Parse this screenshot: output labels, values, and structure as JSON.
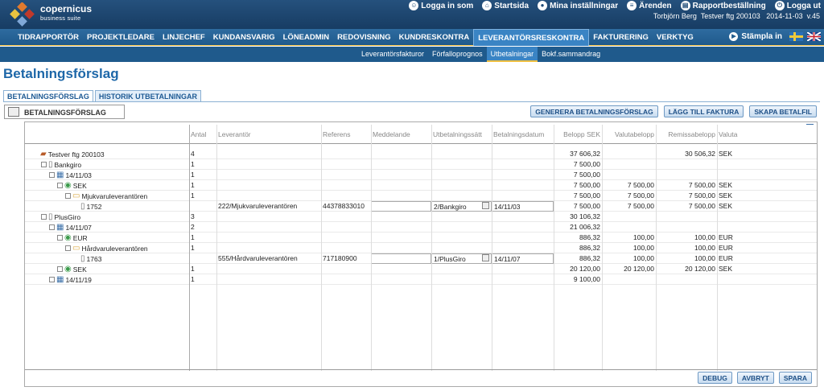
{
  "brand": {
    "name": "copernicus",
    "tagline": "business suite"
  },
  "top_links": [
    "Logga in som",
    "Startsida",
    "Mina inställningar",
    "Ärenden",
    "Rapportbeställning",
    "Logga ut"
  ],
  "user_info": {
    "user": "Torbjörn Berg",
    "company": "Testver ftg 200103",
    "date": "2014-11-03",
    "version": "v.45"
  },
  "main_nav": [
    "TIDRAPPORTÖR",
    "PROJEKTLEDARE",
    "LINJECHEF",
    "KUNDANSVARIG",
    "LÖNEADMIN",
    "REDOVISNING",
    "KUNDRESKONTRA",
    "LEVERANTÖRSRESKONTRA",
    "FAKTURERING",
    "VERKTYG"
  ],
  "main_nav_active": "LEVERANTÖRSRESKONTRA",
  "stampla_label": "Stämpla in",
  "sub_nav": [
    "Leverantörsfakturor",
    "Förfalloprognos",
    "Utbetalningar",
    "Bokf.sammandrag"
  ],
  "sub_nav_active": "Utbetalningar",
  "page_title": "Betalningsförslag",
  "outer_tabs": [
    "BETALNINGSFÖRSLAG",
    "HISTORIK UTBETALNINGAR"
  ],
  "inner_tab": "BETALNINGSFÖRSLAG",
  "action_buttons": [
    "GENERERA BETALNINGSFÖRSLAG",
    "LÄGG TILL FAKTURA",
    "SKAPA BETALFIL"
  ],
  "columns": [
    "Antal",
    "Leverantör",
    "Referens",
    "Meddelande",
    "Utbetalningssätt",
    "Betalningsdatum",
    "Belopp SEK",
    "Valutabelopp",
    "Remissabelopp",
    "Valuta"
  ],
  "rows": [
    {
      "tree": "Testver ftg 200103",
      "level": 0,
      "icon": "company",
      "pm": "",
      "antal": "4",
      "lev": "",
      "ref": "",
      "med": "",
      "utb": "",
      "datum": "",
      "belopp": "37 606,32",
      "valuta_belopp": "",
      "remiss": "30 506,32",
      "valuta": "SEK"
    },
    {
      "tree": "Bankgiro",
      "level": 1,
      "icon": "doc",
      "pm": "−",
      "antal": "1",
      "lev": "",
      "ref": "",
      "med": "",
      "utb": "",
      "datum": "",
      "belopp": "7 500,00",
      "valuta_belopp": "",
      "remiss": "",
      "valuta": ""
    },
    {
      "tree": "14/11/03",
      "level": 2,
      "icon": "calendar",
      "pm": "−",
      "antal": "1",
      "lev": "",
      "ref": "",
      "med": "",
      "utb": "",
      "datum": "",
      "belopp": "7 500,00",
      "valuta_belopp": "",
      "remiss": "",
      "valuta": ""
    },
    {
      "tree": "SEK",
      "level": 3,
      "icon": "currency",
      "pm": "−",
      "antal": "1",
      "lev": "",
      "ref": "",
      "med": "",
      "utb": "",
      "datum": "",
      "belopp": "7 500,00",
      "valuta_belopp": "7 500,00",
      "remiss": "7 500,00",
      "valuta": "SEK"
    },
    {
      "tree": "Mjukvaruleverantören",
      "level": 4,
      "icon": "folder",
      "pm": "−",
      "antal": "1",
      "lev": "",
      "ref": "",
      "med": "",
      "utb": "",
      "datum": "",
      "belopp": "7 500,00",
      "valuta_belopp": "7 500,00",
      "remiss": "7 500,00",
      "valuta": "SEK"
    },
    {
      "tree": "1752",
      "level": 5,
      "icon": "doc",
      "pm": "",
      "antal": "",
      "lev": "222/Mjukvaruleverantören",
      "ref": "44378833010",
      "med": "",
      "utb": "2/Bankgiro",
      "datum": "14/11/03",
      "belopp": "7 500,00",
      "valuta_belopp": "7 500,00",
      "remiss": "7 500,00",
      "valuta": "SEK"
    },
    {
      "tree": "PlusGiro",
      "level": 1,
      "icon": "doc",
      "pm": "−",
      "antal": "3",
      "lev": "",
      "ref": "",
      "med": "",
      "utb": "",
      "datum": "",
      "belopp": "30 106,32",
      "valuta_belopp": "",
      "remiss": "",
      "valuta": ""
    },
    {
      "tree": "14/11/07",
      "level": 2,
      "icon": "calendar",
      "pm": "−",
      "antal": "2",
      "lev": "",
      "ref": "",
      "med": "",
      "utb": "",
      "datum": "",
      "belopp": "21 006,32",
      "valuta_belopp": "",
      "remiss": "",
      "valuta": ""
    },
    {
      "tree": "EUR",
      "level": 3,
      "icon": "currency",
      "pm": "−",
      "antal": "1",
      "lev": "",
      "ref": "",
      "med": "",
      "utb": "",
      "datum": "",
      "belopp": "886,32",
      "valuta_belopp": "100,00",
      "remiss": "100,00",
      "valuta": "EUR"
    },
    {
      "tree": "Hårdvaruleverantören",
      "level": 4,
      "icon": "folder",
      "pm": "−",
      "antal": "1",
      "lev": "",
      "ref": "",
      "med": "",
      "utb": "",
      "datum": "",
      "belopp": "886,32",
      "valuta_belopp": "100,00",
      "remiss": "100,00",
      "valuta": "EUR"
    },
    {
      "tree": "1763",
      "level": 5,
      "icon": "doc",
      "pm": "",
      "antal": "",
      "lev": "555/Hårdvaruleverantören",
      "ref": "717180900",
      "med": "",
      "utb": "1/PlusGiro",
      "datum": "14/11/07",
      "belopp": "886,32",
      "valuta_belopp": "100,00",
      "remiss": "100,00",
      "valuta": "EUR"
    },
    {
      "tree": "SEK",
      "level": 3,
      "icon": "currency",
      "pm": "+",
      "antal": "1",
      "lev": "",
      "ref": "",
      "med": "",
      "utb": "",
      "datum": "",
      "belopp": "20 120,00",
      "valuta_belopp": "20 120,00",
      "remiss": "20 120,00",
      "valuta": "SEK"
    },
    {
      "tree": "14/11/19",
      "level": 2,
      "icon": "calendar",
      "pm": "+",
      "antal": "1",
      "lev": "",
      "ref": "",
      "med": "",
      "utb": "",
      "datum": "",
      "belopp": "9 100,00",
      "valuta_belopp": "",
      "remiss": "",
      "valuta": ""
    }
  ],
  "bottom_buttons": [
    "DEBUG",
    "AVBRYT",
    "SPARA"
  ],
  "colors": {
    "topbar": "#1d4a77",
    "nav": "#2463a0",
    "accent": "#f0c040",
    "title": "#1d67a8"
  }
}
